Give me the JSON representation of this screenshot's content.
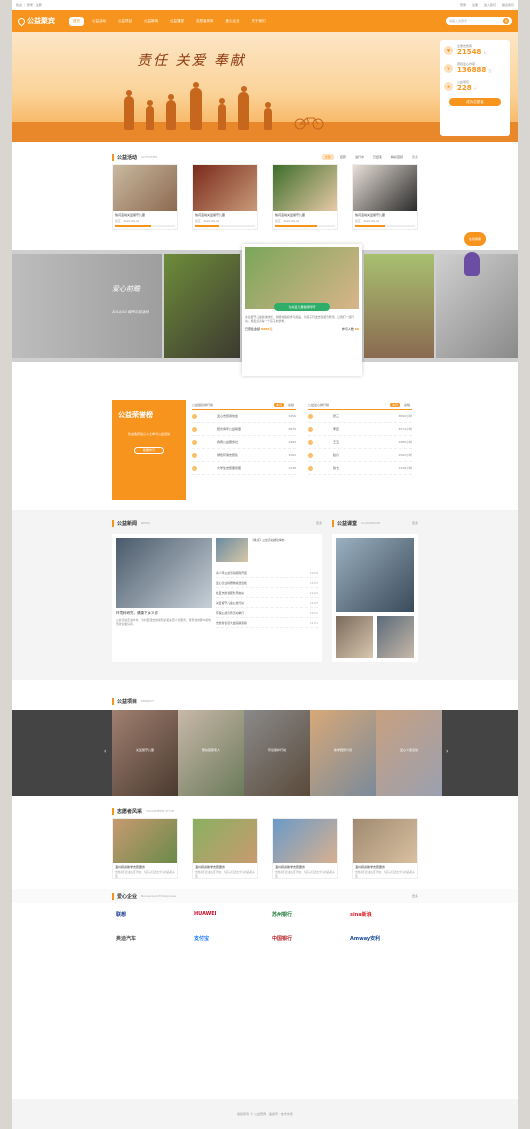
{
  "topbar": {
    "left": "欢迎 ｜ 登录 · 注册",
    "links": [
      "登录",
      "注册",
      "加入我们",
      "联系我们"
    ]
  },
  "brand": {
    "name": "公益聚宾",
    "primary_color": "#f7941d"
  },
  "nav": {
    "items": [
      "首页",
      "公益活动",
      "公益项目",
      "公益新闻",
      "公益课堂",
      "志愿者风采",
      "爱心企业",
      "关于我们"
    ],
    "active_index": 0,
    "search_placeholder": "请输入关键字",
    "search_button": "搜"
  },
  "banner": {
    "slogan": "责任 关爱 奉献",
    "stats": [
      {
        "icon": "heart-icon",
        "label": "注册志愿者",
        "value": "21548",
        "unit": "人"
      },
      {
        "icon": "coin-icon",
        "label": "募捐爱心款项",
        "value": "136888",
        "unit": "元"
      },
      {
        "icon": "project-icon",
        "label": "公益项目",
        "value": "228",
        "unit": "个"
      }
    ],
    "join_button": "成为志愿者"
  },
  "activities": {
    "title": "公益活动",
    "en": "ACTIVITIES",
    "tabs": [
      "全部",
      "招募",
      "进行中",
      "已结束",
      "精彩回顾"
    ],
    "active_tab": 0,
    "more": "更多",
    "cards": [
      {
        "title": "快闪活动关爱留守儿童",
        "meta": "北京 · 2023-06-01",
        "progress": 0.6
      },
      {
        "title": "快闪活动关爱留守儿童",
        "meta": "北京 · 2023-06-01",
        "progress": 0.4
      },
      {
        "title": "快闪活动关爱留守儿童",
        "meta": "北京 · 2023-06-01",
        "progress": 0.7
      },
      {
        "title": "快闪活动关爱留守儿童",
        "meta": "北京 · 2023-06-01",
        "progress": 0.5
      }
    ],
    "float_help": "在线客服"
  },
  "love": {
    "title": "爱心前瞻",
    "sub": "2014/10 相关公益活动",
    "feature_badge": "为关爱儿童健康呼吁",
    "feature_text": "关注留守儿童健康成长，捐赠书籍和学习用品，为孩子们送去温暖与希望。让我们一起行动，用爱点亮每一个孩子的梦想。",
    "raised_label": "已募集金额",
    "raised_value": "8866元",
    "people_label": "参与人数",
    "people_value": "86"
  },
  "rank": {
    "title": "公益荣誉榜",
    "desc": "欢迎各界爱心人士参与公益活动",
    "button": "我要参与",
    "left": {
      "title": "公益组织排行榜",
      "toggles": [
        "本月",
        "总榜"
      ],
      "headers": [
        "排名",
        "组织名称",
        "参与人次"
      ],
      "rows": [
        {
          "name": "爱心志愿者协会",
          "value": "3256"
        },
        {
          "name": "阳光青年公益联盟",
          "value": "2876"
        },
        {
          "name": "春雨公益服务社",
          "value": "1980"
        },
        {
          "name": "绿色环保志愿队",
          "value": "1562"
        },
        {
          "name": "大学生志愿服务团",
          "value": "1248"
        }
      ]
    },
    "right": {
      "title": "公益爱心排行榜",
      "toggles": [
        "本月",
        "总榜"
      ],
      "headers": [
        "排名",
        "姓名",
        "公益时长"
      ],
      "rows": [
        {
          "name": "张三",
          "value": "3896小时"
        },
        {
          "name": "李四",
          "value": "3574小时"
        },
        {
          "name": "王五",
          "value": "1980小时"
        },
        {
          "name": "赵六",
          "value": "1562小时"
        },
        {
          "name": "钱七",
          "value": "1248小时"
        }
      ]
    }
  },
  "news": {
    "title": "公益新闻",
    "en": "NEWS",
    "more": "更多",
    "lead_title": "环境科研究，健康下乡义诊",
    "lead_text": "公益活动走进乡村，为村民送去健康知识和免费义诊服务，受到当地群众的热烈欢迎和好评。",
    "side_title": "【重点】公益活动成功举办",
    "items": [
      {
        "title": "青少年公益活动顺利开展",
        "date": "12-06"
      },
      {
        "title": "爱心企业捐赠物资送温暖",
        "date": "12-05"
      },
      {
        "title": "社区志愿者服务周启动",
        "date": "12-04"
      },
      {
        "title": "关爱留守儿童公益行动",
        "date": "12-03"
      },
      {
        "title": "环保公益宣传活动举行",
        "date": "12-02"
      },
      {
        "title": "志愿者表彰大会圆满落幕",
        "date": "12-01"
      }
    ]
  },
  "class": {
    "title": "公益课堂",
    "en": "CLASSROOM",
    "more": "更多"
  },
  "projects": {
    "title": "公益项目",
    "en": "PROJECT",
    "items": [
      "关爱留守儿童",
      "帮扶孤寡老人",
      "环境保护行动",
      "助学圆梦计划",
      "爱心义卖活动"
    ]
  },
  "volunteers": {
    "title": "志愿者风采",
    "en": "VOLUNTEER STYLE",
    "cards": [
      {
        "title": "温州捐资助学志愿服务",
        "text": "志愿者们走进山区学校，为孩子们送去学习用品和关爱。"
      },
      {
        "title": "温州捐资助学志愿服务",
        "text": "志愿者们走进山区学校，为孩子们送去学习用品和关爱。"
      },
      {
        "title": "温州捐资助学志愿服务",
        "text": "志愿者们走进山区学校，为孩子们送去学习用品和关爱。"
      },
      {
        "title": "温州捐资助学志愿服务",
        "text": "志愿者们走进山区学校，为孩子们送去学习用品和关爱。"
      }
    ]
  },
  "partners": {
    "title": "爱心企业",
    "en": "Benevolent Enterprises",
    "more": "更多",
    "logos": [
      {
        "name": "联想",
        "color": "#1a3a8a"
      },
      {
        "name": "HUAWEI",
        "color": "#c8102e"
      },
      {
        "name": "苏州银行",
        "color": "#1f7a3a"
      },
      {
        "name": "sina新浪",
        "color": "#d8232a"
      },
      {
        "name": "奥迪汽车",
        "color": "#555555"
      },
      {
        "name": "支付宝",
        "color": "#1677ff"
      },
      {
        "name": "中国银行",
        "color": "#b81c22"
      },
      {
        "name": "Amway安利",
        "color": "#1b4c9a"
      }
    ]
  },
  "footer": {
    "text": "版权所有 © 公益聚宾 · 备案号 · 技术支持"
  }
}
